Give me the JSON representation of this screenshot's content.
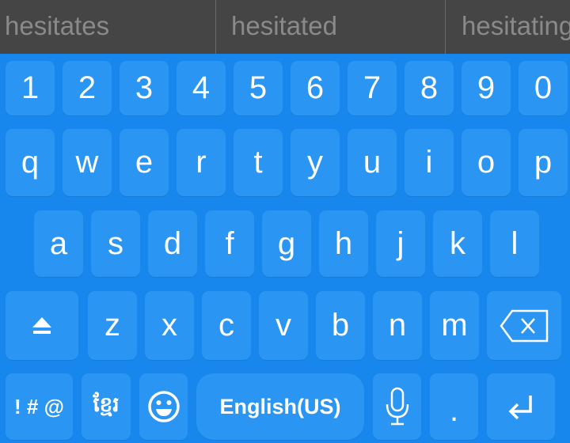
{
  "suggestions": [
    "hesitates",
    "hesitated",
    "hesitating"
  ],
  "colors": {
    "background": "#1787ee",
    "key": "#2b95f3",
    "suggestion_bar": "#454545",
    "suggestion_text": "#8a8a8a"
  },
  "rows": [
    [
      "1",
      "2",
      "3",
      "4",
      "5",
      "6",
      "7",
      "8",
      "9",
      "0"
    ],
    [
      "q",
      "w",
      "e",
      "r",
      "t",
      "y",
      "u",
      "i",
      "o",
      "p"
    ],
    [
      "a",
      "s",
      "d",
      "f",
      "g",
      "h",
      "j",
      "k",
      "l"
    ],
    [
      "z",
      "x",
      "c",
      "v",
      "b",
      "n",
      "m"
    ]
  ],
  "special": {
    "shift_icon": "shift-icon",
    "backspace_icon": "backspace-icon",
    "symbols_label": "! # @",
    "language_switch_label": "ខ្មែរ",
    "emoji_icon": "emoji-icon",
    "space_label": "English(US)",
    "mic_icon": "microphone-icon",
    "period_label": ".",
    "enter_icon": "enter-icon"
  }
}
